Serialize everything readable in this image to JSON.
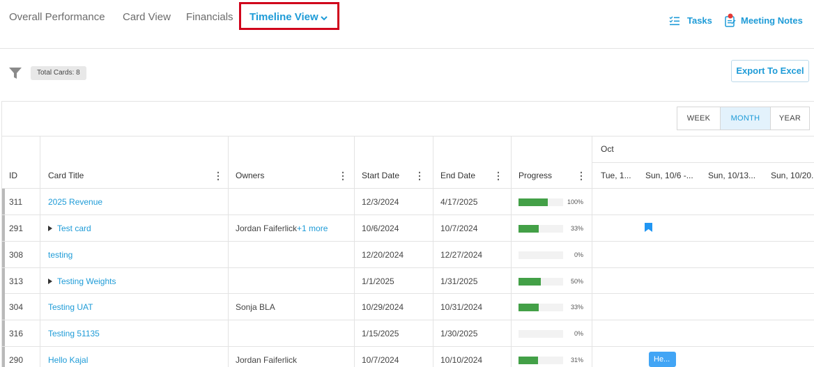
{
  "nav": {
    "tabs": [
      "Overall Performance",
      "Card View",
      "Financials"
    ],
    "active_tab": "Timeline View",
    "right_links": {
      "tasks": "Tasks",
      "meeting_notes": "Meeting Notes"
    }
  },
  "toolbar": {
    "total_cards": "Total Cards: 8",
    "export_label": "Export To Excel"
  },
  "view_toggle": {
    "week": "WEEK",
    "month": "MONTH",
    "year": "YEAR",
    "selected": "MONTH"
  },
  "columns": {
    "id": "ID",
    "title": "Card Title",
    "owners": "Owners",
    "start": "Start Date",
    "end": "End Date",
    "progress": "Progress"
  },
  "timeline": {
    "month": "Oct",
    "weeks": [
      "Tue, 1...",
      "Sun, 10/6 -...",
      "Sun, 10/13...",
      "Sun, 10/20."
    ]
  },
  "rows": [
    {
      "id": "311",
      "title": "2025 Revenue",
      "owners": "",
      "owners_more": "",
      "start": "12/3/2024",
      "end": "4/17/2025",
      "progress_label": "100%",
      "progress": 1.0,
      "expandable": false
    },
    {
      "id": "291",
      "title": "Test card",
      "owners": "Jordan Faiferlick",
      "owners_more": "+1 more",
      "start": "10/6/2024",
      "end": "10/7/2024",
      "progress_label": "33%",
      "progress": 0.33,
      "expandable": true
    },
    {
      "id": "308",
      "title": "testing",
      "owners": "",
      "owners_more": "",
      "start": "12/20/2024",
      "end": "12/27/2024",
      "progress_label": "0%",
      "progress": 0,
      "expandable": false
    },
    {
      "id": "313",
      "title": "Testing Weights",
      "owners": "",
      "owners_more": "",
      "start": "1/1/2025",
      "end": "1/31/2025",
      "progress_label": "50%",
      "progress": 0.5,
      "expandable": true
    },
    {
      "id": "304",
      "title": "Testing UAT",
      "owners": "Sonja BLA",
      "owners_more": "",
      "start": "10/29/2024",
      "end": "10/31/2024",
      "progress_label": "33%",
      "progress": 0.33,
      "expandable": false
    },
    {
      "id": "316",
      "title": "Testing 51135",
      "owners": "",
      "owners_more": "",
      "start": "1/15/2025",
      "end": "1/30/2025",
      "progress_label": "0%",
      "progress": 0,
      "expandable": false
    },
    {
      "id": "290",
      "title": "Hello Kajal",
      "owners": "Jordan Faiferlick",
      "owners_more": "",
      "start": "10/7/2024",
      "end": "10/10/2024",
      "progress_label": "31%",
      "progress": 0.31,
      "expandable": false
    }
  ],
  "timeline_bar_label": "He...",
  "colors": {
    "accent": "#1e9bd7",
    "progress": "#43a047",
    "timeline_bar": "#42a5f5",
    "highlight_box": "#d0021b"
  },
  "icons": {
    "filter": "funnel-icon",
    "tasks": "checklist-icon",
    "meeting_notes": "notes-bell-icon",
    "milestone": "bookmark-icon"
  }
}
